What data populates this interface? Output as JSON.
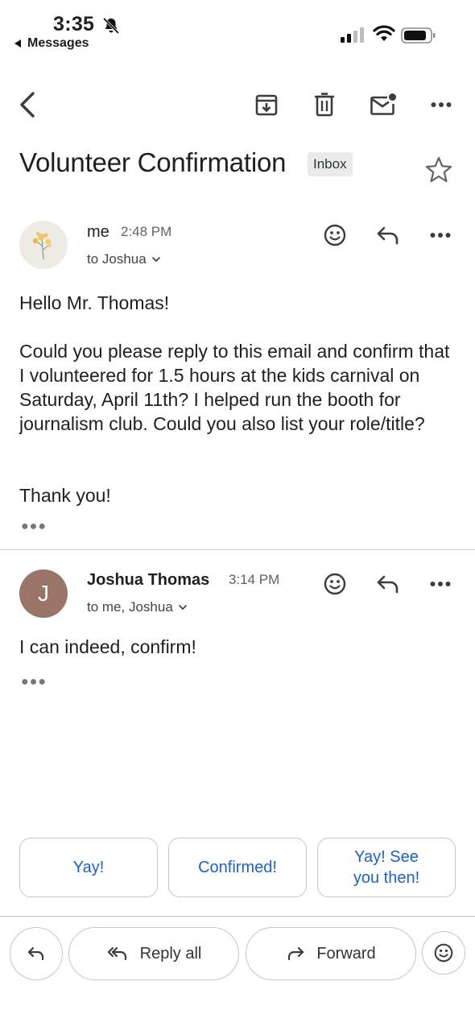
{
  "status_bar": {
    "time": "3:35",
    "back_app": "Messages"
  },
  "email": {
    "subject": "Volunteer Confirmation",
    "label": "Inbox"
  },
  "messages": [
    {
      "sender": "me",
      "time": "2:48 PM",
      "to": "to Joshua",
      "body": [
        "Hello Mr. Thomas!",
        "Could you please reply to this email and confirm that I volunteered for 1.5 hours at the kids carnival on Saturday, April 11th? I helped run the booth for journalism club. Could you also list your role/title?",
        "Thank you!"
      ]
    },
    {
      "sender": "Joshua Thomas",
      "avatar_letter": "J",
      "time": "3:14 PM",
      "to": "to me, Joshua",
      "body": [
        "I can indeed, confirm!"
      ]
    }
  ],
  "smart_replies": [
    "Yay!",
    "Confirmed!",
    "Yay! See you then!"
  ],
  "actions": {
    "reply_all": "Reply all",
    "forward": "Forward"
  },
  "colors": {
    "accent": "#1a62c7",
    "avatar_j": "#9a7466",
    "chip_bg": "#e9eaeb"
  },
  "icons": [
    "bell-muted-icon",
    "signal-icon",
    "wifi-icon",
    "battery-icon",
    "back-arrow-icon",
    "archive-icon",
    "trash-icon",
    "mark-unread-icon",
    "more-icon",
    "star-icon",
    "emoji-icon",
    "reply-icon",
    "reply-all-icon",
    "forward-icon",
    "chevron-down-icon"
  ]
}
